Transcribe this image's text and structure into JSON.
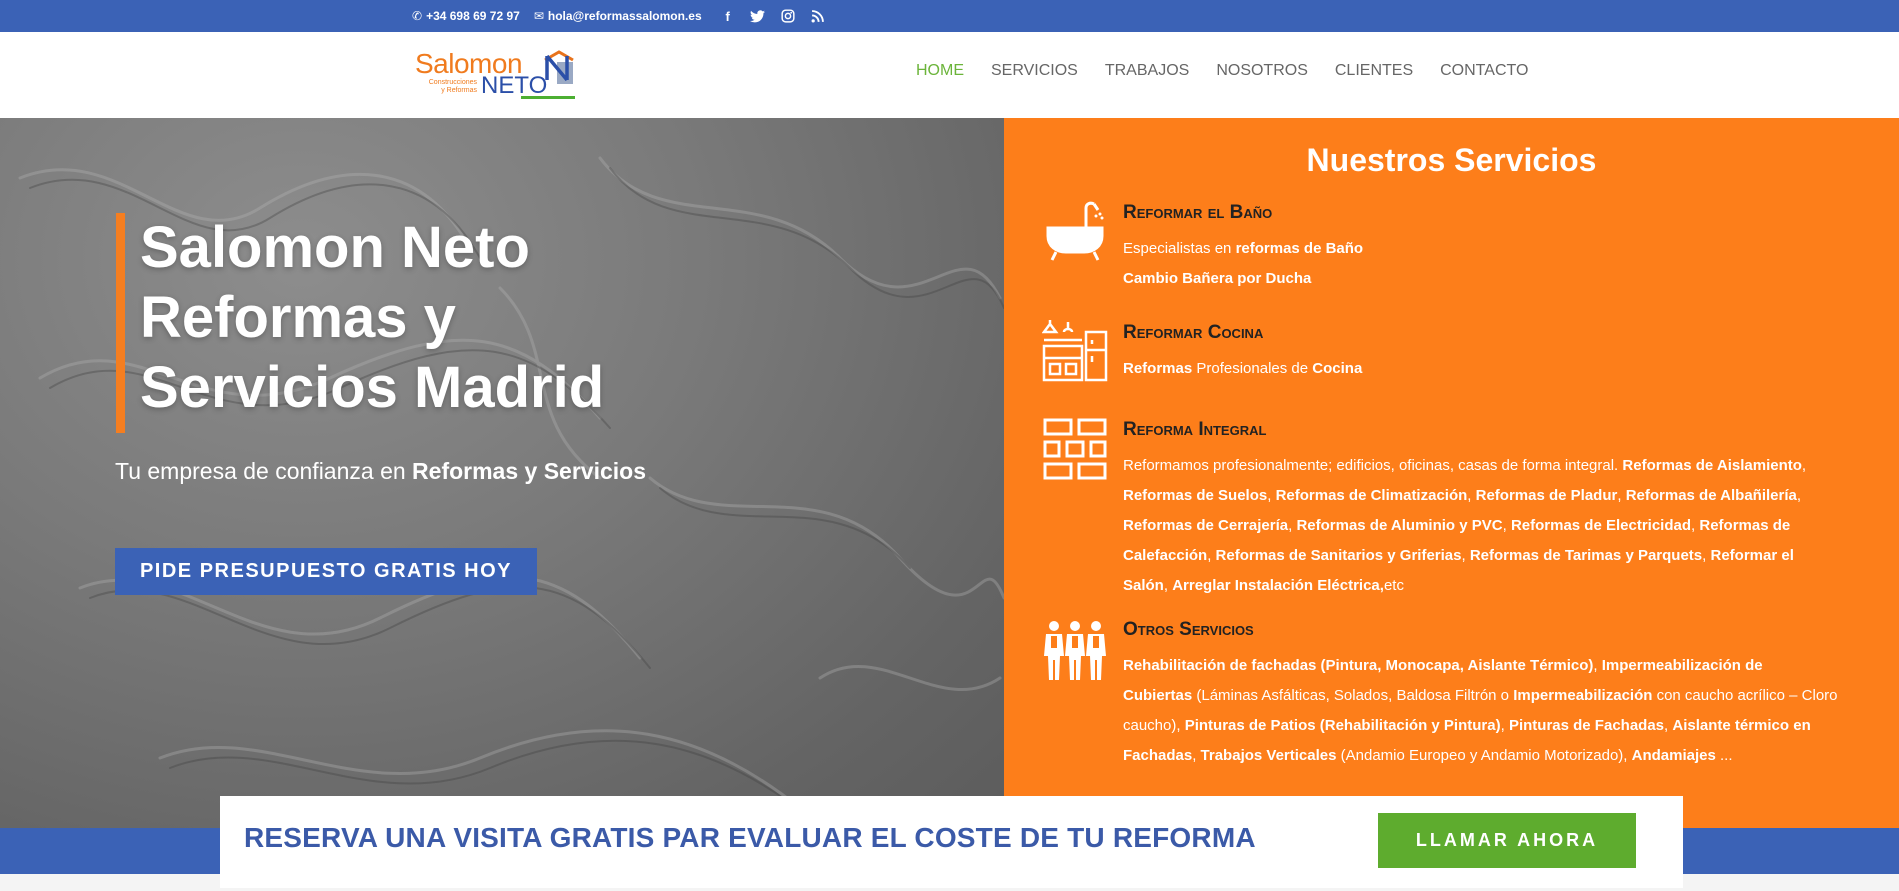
{
  "topbar": {
    "phone": "+34 698 69 72 97",
    "email": "hola@reformassalomon.es",
    "social": [
      "facebook-icon",
      "twitter-icon",
      "instagram-icon",
      "rss-icon"
    ]
  },
  "logo": {
    "word1": "Salomon",
    "word2": "NETO",
    "tagline_1": "Construcciones",
    "tagline_2": "y Reformas"
  },
  "nav": {
    "items": [
      "HOME",
      "SERVICIOS",
      "TRABAJOS",
      "NOSOTROS",
      "CLIENTES",
      "CONTACTO"
    ],
    "active": "HOME"
  },
  "hero": {
    "title_line1": "Salomon Neto",
    "title_line2": "Reformas y",
    "title_line3": "Servicios Madrid",
    "subtitle_prefix": "Tu empresa de confianza en ",
    "subtitle_bold": "Reformas y Servicios",
    "button": "PIDE PRESUPUESTO GRATIS HOY"
  },
  "services": {
    "heading": "Nuestros Servicios",
    "items": [
      {
        "icon": "bathtub-icon",
        "name": "Reformar el Baño",
        "lines": [
          [
            {
              "t": "Especialistas en ",
              "b": false
            },
            {
              "t": "reformas de Baño",
              "b": true
            }
          ],
          [
            {
              "t": "Cambio Bañera por Ducha",
              "b": true
            }
          ]
        ]
      },
      {
        "icon": "kitchen-icon",
        "name": "Reformar Cocina",
        "lines": [
          [
            {
              "t": "Reformas",
              "b": true
            },
            {
              "t": " Profesionales de ",
              "b": false
            },
            {
              "t": "Cocina",
              "b": true
            }
          ]
        ]
      },
      {
        "icon": "bricks-icon",
        "name": "Reforma Integral",
        "lines": [
          [
            {
              "t": "Reformamos profesionalmente; edificios, oficinas, casas de forma integral. ",
              "b": false
            },
            {
              "t": "Reformas de Aislamiento",
              "b": true
            },
            {
              "t": ",",
              "b": false
            }
          ],
          [
            {
              "t": "Reformas de Suelos",
              "b": true
            },
            {
              "t": ", ",
              "b": false
            },
            {
              "t": "Reformas de Climatización",
              "b": true
            },
            {
              "t": ", ",
              "b": false
            },
            {
              "t": "Reformas de Pladur",
              "b": true
            },
            {
              "t": ", ",
              "b": false
            },
            {
              "t": "Reformas de Albañilería",
              "b": true
            },
            {
              "t": ",",
              "b": false
            }
          ],
          [
            {
              "t": "Reformas de Cerrajería",
              "b": true
            },
            {
              "t": ", ",
              "b": false
            },
            {
              "t": "Reformas de Aluminio y PVC",
              "b": true
            },
            {
              "t": ", ",
              "b": false
            },
            {
              "t": "Reformas de Electricidad",
              "b": true
            },
            {
              "t": ", ",
              "b": false
            },
            {
              "t": "Reformas de",
              "b": true
            }
          ],
          [
            {
              "t": "Calefacción",
              "b": true
            },
            {
              "t": ", ",
              "b": false
            },
            {
              "t": "Reformas de Sanitarios y Griferias",
              "b": true
            },
            {
              "t": ", ",
              "b": false
            },
            {
              "t": "Reformas de Tarimas y Parquets",
              "b": true
            },
            {
              "t": ", ",
              "b": false
            },
            {
              "t": "Reformar el",
              "b": true
            }
          ],
          [
            {
              "t": "Salón",
              "b": true
            },
            {
              "t": ", ",
              "b": false
            },
            {
              "t": "Arreglar Instalación Eléctrica,",
              "b": true
            },
            {
              "t": "etc",
              "b": false
            }
          ]
        ]
      },
      {
        "icon": "workers-icon",
        "name": "Otros Servicios",
        "lines": [
          [
            {
              "t": "Rehabilitación de fachadas (Pintura, Monocapa, Aislante Térmico)",
              "b": true
            },
            {
              "t": ", ",
              "b": false
            },
            {
              "t": "Impermeabilización de",
              "b": true
            }
          ],
          [
            {
              "t": "Cubiertas",
              "b": true
            },
            {
              "t": " (Láminas Asfálticas, Solados, Baldosa Filtrón o ",
              "b": false
            },
            {
              "t": "Impermeabilización",
              "b": true
            },
            {
              "t": " con caucho acrílico – Cloro",
              "b": false
            }
          ],
          [
            {
              "t": "caucho), ",
              "b": false
            },
            {
              "t": "Pinturas de Patios (Rehabilitación y Pintura)",
              "b": true
            },
            {
              "t": ", ",
              "b": false
            },
            {
              "t": "Pinturas de Fachadas",
              "b": true
            },
            {
              "t": ", ",
              "b": false
            },
            {
              "t": "Aislante térmico en",
              "b": true
            }
          ],
          [
            {
              "t": "Fachadas",
              "b": true
            },
            {
              "t": ", ",
              "b": false
            },
            {
              "t": "Trabajos Verticales",
              "b": true
            },
            {
              "t": " (Andamio Europeo y Andamio Motorizado), ",
              "b": false
            },
            {
              "t": "Andamiajes",
              "b": true
            },
            {
              "t": " ...",
              "b": false
            }
          ]
        ]
      }
    ]
  },
  "cta": {
    "text": "RESERVA UNA VISITA GRATIS PAR EVALUAR EL COSTE DE TU REFORMA",
    "button": "LLAMAR AHORA"
  },
  "colors": {
    "blue": "#3b62b6",
    "orange": "#fd7e1a",
    "green": "#5eac2e",
    "nav_active": "#6bb43a"
  }
}
